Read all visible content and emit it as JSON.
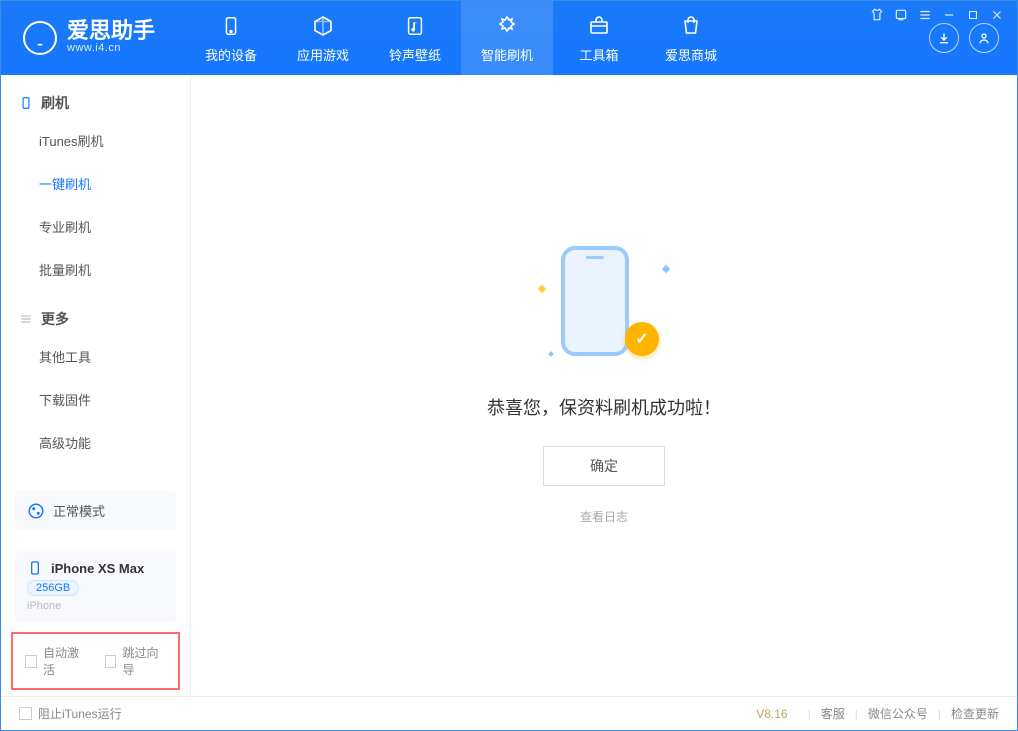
{
  "app": {
    "name": "爱思助手",
    "domain": "www.i4.cn"
  },
  "tabs": {
    "device": "我的设备",
    "apps": "应用游戏",
    "ringtones": "铃声壁纸",
    "flash": "智能刷机",
    "toolbox": "工具箱",
    "store": "爱思商城"
  },
  "sidebar": {
    "section_flash": "刷机",
    "itunes_flash": "iTunes刷机",
    "oneclick_flash": "一键刷机",
    "pro_flash": "专业刷机",
    "batch_flash": "批量刷机",
    "section_more": "更多",
    "other_tools": "其他工具",
    "download_fw": "下载固件",
    "advanced": "高级功能"
  },
  "mode_card": {
    "label": "正常模式"
  },
  "device": {
    "name": "iPhone XS Max",
    "capacity": "256GB",
    "type": "iPhone"
  },
  "checks": {
    "auto_activate": "自动激活",
    "skip_setup": "跳过向导"
  },
  "main": {
    "success_msg": "恭喜您，保资料刷机成功啦！",
    "ok": "确定",
    "view_log": "查看日志"
  },
  "status": {
    "block_itunes": "阻止iTunes运行",
    "version": "V8.16",
    "support": "客服",
    "wechat": "微信公众号",
    "check_update": "检查更新"
  }
}
